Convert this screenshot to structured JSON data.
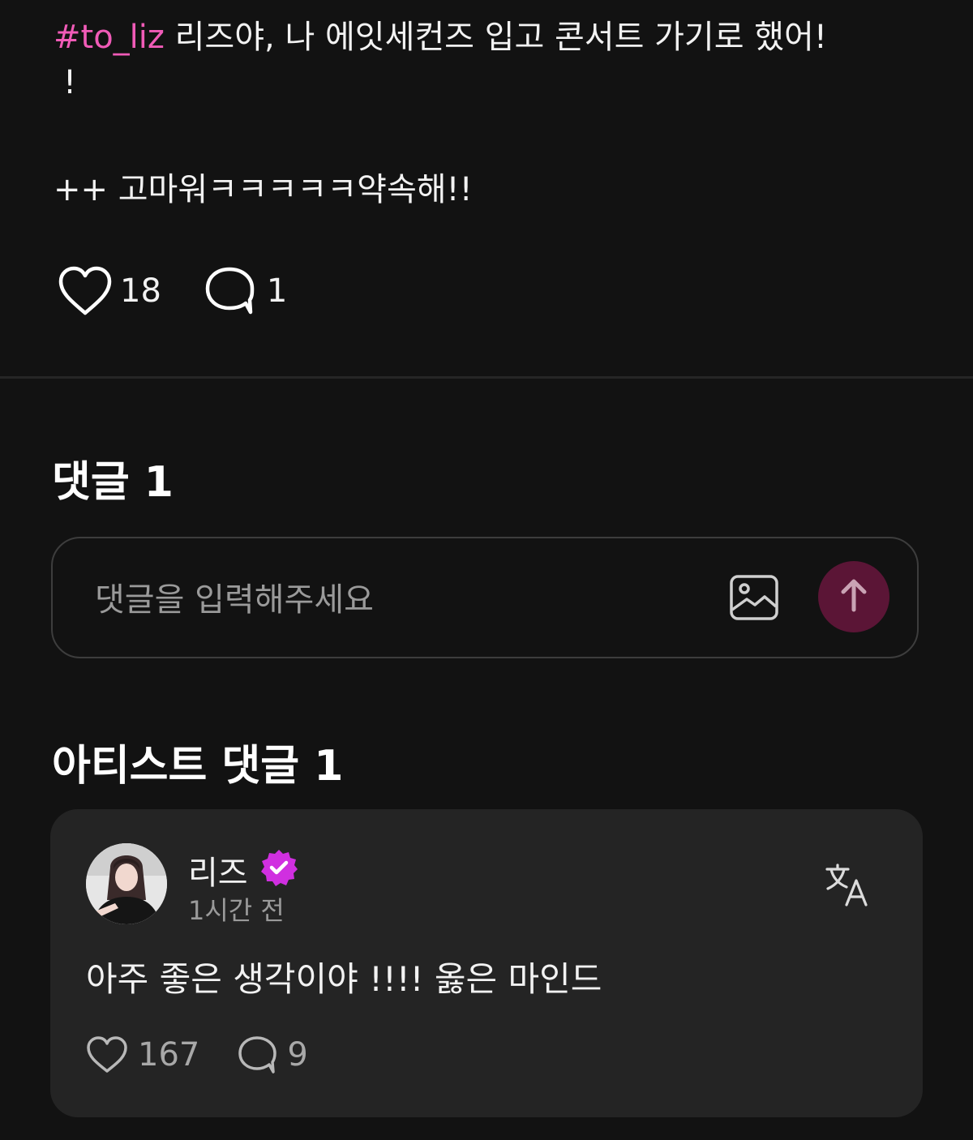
{
  "post": {
    "hashtag": "#to_liz",
    "line1_text": " 리즈야, 나 에잇세컨즈 입고 콘서트 가기로 했어!",
    "line2_text": "!",
    "line3_text": "++ 고마워ㅋㅋㅋㅋㅋ약속해!!",
    "like_count": "18",
    "comment_count": "1"
  },
  "comments_section": {
    "title": "댓글 1",
    "input_placeholder": "댓글을 입력해주세요"
  },
  "artist_section": {
    "title": "아티스트 댓글 1",
    "comment": {
      "author": "리즈",
      "time": "1시간 전",
      "text": "아주 좋은 생각이야 !!!! 옳은 마인드",
      "like_count": "167",
      "reply_count": "9"
    }
  },
  "colors": {
    "background": "#121212",
    "hashtag": "#f05bb7",
    "send_button": "#5b1536",
    "card_background": "#242424",
    "verified_badge": "#d02fe0"
  },
  "icons": {
    "like": "heart-icon",
    "comment": "speech-bubble-icon",
    "image": "image-icon",
    "send": "arrow-up-icon",
    "verified": "verified-badge-icon",
    "translate": "translate-icon"
  }
}
